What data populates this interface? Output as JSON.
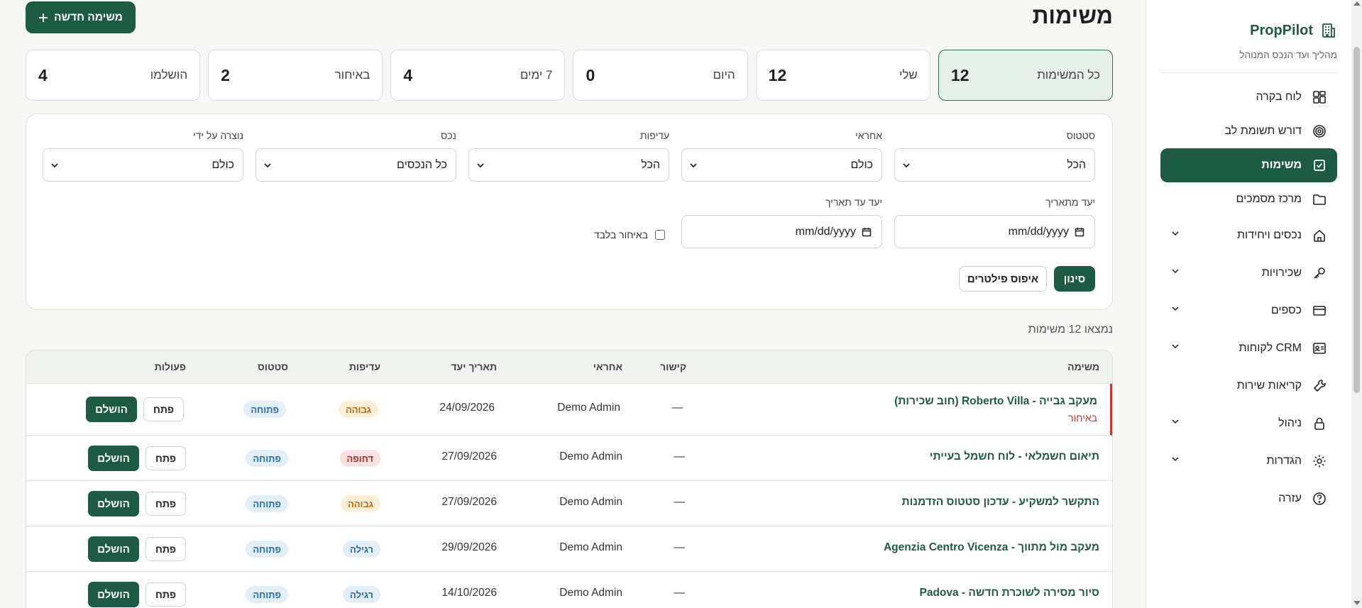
{
  "app": {
    "brand": "PropPilot",
    "tagline": "מהליך ועד הנכס המנוהל"
  },
  "sidebar": {
    "items": [
      {
        "label": "לוח בקרה",
        "icon": "dashboard-icon",
        "active": false,
        "expandable": false
      },
      {
        "label": "דורש תשומת לב",
        "icon": "target-icon",
        "active": false,
        "expandable": false
      },
      {
        "label": "משימות",
        "icon": "checkbox-icon",
        "active": true,
        "expandable": false
      },
      {
        "label": "מרכז מסמכים",
        "icon": "folder-icon",
        "active": false,
        "expandable": false
      },
      {
        "label": "נכסים ויחידות",
        "icon": "home-icon",
        "active": false,
        "expandable": true
      },
      {
        "label": "שכירויות",
        "icon": "key-icon",
        "active": false,
        "expandable": true
      },
      {
        "label": "כספים",
        "icon": "credit-card-icon",
        "active": false,
        "expandable": true
      },
      {
        "label": "CRM לקוחות",
        "icon": "contact-card-icon",
        "active": false,
        "expandable": true
      },
      {
        "label": "קריאות שירות",
        "icon": "wrench-icon",
        "active": false,
        "expandable": false
      },
      {
        "label": "ניהול",
        "icon": "lock-icon",
        "active": false,
        "expandable": true
      },
      {
        "label": "הגדרות",
        "icon": "gear-icon",
        "active": false,
        "expandable": true
      },
      {
        "label": "עזרה",
        "icon": "help-icon",
        "active": false,
        "expandable": false
      }
    ]
  },
  "header": {
    "title": "משימות",
    "new_task_label": "משימה חדשה",
    "new_task_icon": "plus-icon"
  },
  "stats": [
    {
      "label": "כל המשימות",
      "value": "12",
      "active": true
    },
    {
      "label": "שלי",
      "value": "12",
      "active": false
    },
    {
      "label": "היום",
      "value": "0",
      "active": false
    },
    {
      "label": "7 ימים",
      "value": "4",
      "active": false
    },
    {
      "label": "באיחור",
      "value": "2",
      "active": false
    },
    {
      "label": "הושלמו",
      "value": "4",
      "active": false
    }
  ],
  "filters": {
    "status": {
      "label": "סטטוס",
      "value": "הכל"
    },
    "assignee": {
      "label": "אחראי",
      "value": "כולם"
    },
    "priority": {
      "label": "עדיפות",
      "value": "הכל"
    },
    "property": {
      "label": "נכס",
      "value": "כל הנכסים"
    },
    "created_by": {
      "label": "נוצרה על ידי",
      "value": "כולם"
    },
    "from_date": {
      "label": "יעד מתאריך",
      "placeholder": "mm/dd/yyyy"
    },
    "to_date": {
      "label": "יעד עד תאריך",
      "placeholder": "mm/dd/yyyy"
    },
    "overdue_only": {
      "label": "באיחור בלבד",
      "checked": false
    },
    "filter_button": "סינון",
    "reset_button": "איפוס פילטרים"
  },
  "results_text": "נמצאו 12 משימות",
  "table": {
    "headers": {
      "task": "משימה",
      "link": "קישור",
      "assignee": "אחראי",
      "due": "תאריך יעד",
      "priority": "עדיפות",
      "status": "סטטוס",
      "actions": "פעולות"
    },
    "open_label": "פתח",
    "done_label": "הושלם",
    "rows": [
      {
        "title": "מעקב גבייה - Roberto Villa (חוב שכירות)",
        "overdue": "באיחור",
        "link": "—",
        "assignee": "Demo Admin",
        "due": "24/09/2026",
        "priority": "גבוהה",
        "priority_kind": "high",
        "status": "פתוחה"
      },
      {
        "title": "תיאום חשמלאי - לוח חשמל בעייתי",
        "overdue": "",
        "link": "—",
        "assignee": "Demo Admin",
        "due": "27/09/2026",
        "priority": "דחופה",
        "priority_kind": "urgent",
        "status": "פתוחה"
      },
      {
        "title": "התקשר למשקיע - עדכון סטטוס הזדמנות",
        "overdue": "",
        "link": "—",
        "assignee": "Demo Admin",
        "due": "27/09/2026",
        "priority": "גבוהה",
        "priority_kind": "high",
        "status": "פתוחה"
      },
      {
        "title": "מעקב מול מתווך - Agenzia Centro Vicenza",
        "overdue": "",
        "link": "—",
        "assignee": "Demo Admin",
        "due": "29/09/2026",
        "priority": "רגילה",
        "priority_kind": "normal",
        "status": "פתוחה"
      },
      {
        "title": "סיור מסירה לשוכרת חדשה - Padova",
        "overdue": "",
        "link": "—",
        "assignee": "Demo Admin",
        "due": "14/10/2026",
        "priority": "רגילה",
        "priority_kind": "normal",
        "status": "פתוחה"
      }
    ]
  },
  "colors": {
    "brand": "#1e5b45",
    "overdue": "#c0392b",
    "active_stat_bg": "#e6f0ea"
  }
}
